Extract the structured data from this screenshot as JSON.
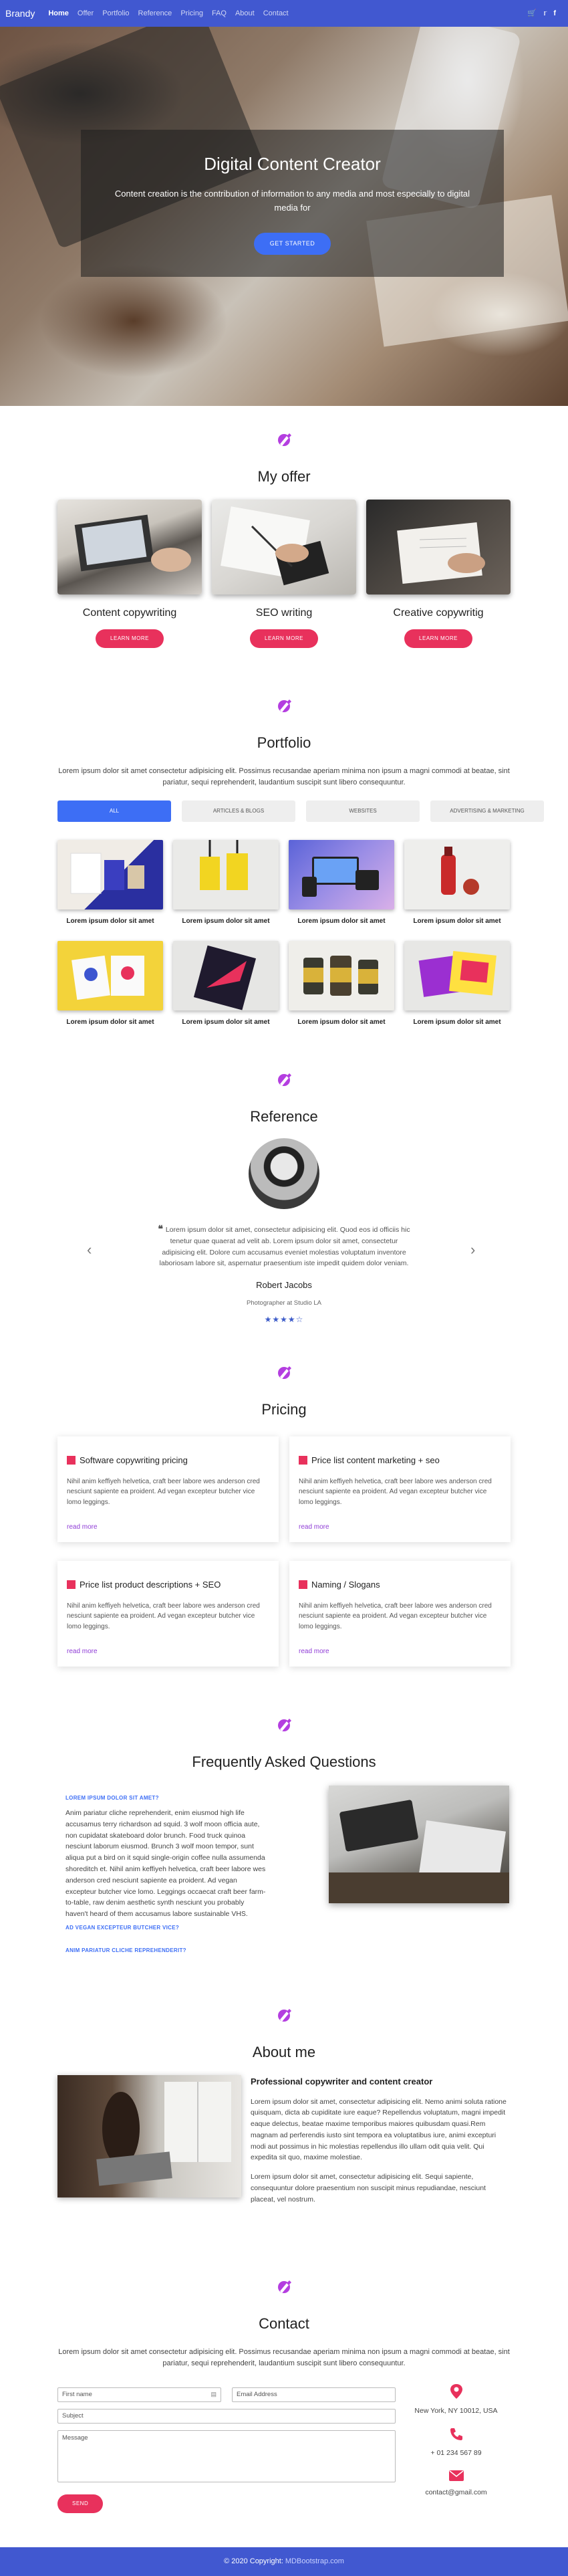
{
  "nav": {
    "brand": "Brandy",
    "links": [
      "Home",
      "Offer",
      "Portfolio",
      "Reference",
      "Pricing",
      "FAQ",
      "About",
      "Contact"
    ],
    "icons": [
      "cart-icon",
      "twitter-icon",
      "facebook-icon"
    ]
  },
  "hero": {
    "title": "Digital Content Creator",
    "subtitle": "Content creation is the contribution of information to any media and most especially to digital media for",
    "button": "GET STARTED"
  },
  "offer": {
    "title": "My offer",
    "cards": [
      {
        "title": "Content copywriting",
        "button": "LEARN MORE"
      },
      {
        "title": "SEO writing",
        "button": "LEARN MORE"
      },
      {
        "title": "Creative copywritig",
        "button": "LEARN MORE"
      }
    ]
  },
  "portfolio": {
    "title": "Portfolio",
    "description": "Lorem ipsum dolor sit amet consectetur adipisicing elit. Possimus recusandae aperiam minima non ipsum a magni commodi at beatae, sint pariatur, sequi reprehenderit, laudantium suscipit sunt libero consequuntur.",
    "filters": [
      "ALL",
      "ARTICLES & BLOGS",
      "WEBSITES",
      "ADVERTISING & MARKETING"
    ],
    "items": [
      "Lorem ipsum dolor sit amet",
      "Lorem ipsum dolor sit amet",
      "Lorem ipsum dolor sit amet",
      "Lorem ipsum dolor sit amet",
      "Lorem ipsum dolor sit amet",
      "Lorem ipsum dolor sit amet",
      "Lorem ipsum dolor sit amet",
      "Lorem ipsum dolor sit amet"
    ]
  },
  "reference": {
    "title": "Reference",
    "quote": "Lorem ipsum dolor sit amet, consectetur adipisicing elit. Quod eos id officiis hic tenetur quae quaerat ad velit ab. Lorem ipsum dolor sit amet, consectetur adipisicing elit. Dolore cum accusamus eveniet molestias voluptatum inventore laboriosam labore sit, aspernatur praesentium iste impedit quidem dolor veniam.",
    "name": "Robert Jacobs",
    "role": "Photographer at Studio LA",
    "rating": 4.5
  },
  "pricing": {
    "title": "Pricing",
    "cards": [
      {
        "title": "Software copywriting pricing",
        "text": "Nihil anim keffiyeh helvetica, craft beer labore wes anderson cred nesciunt sapiente ea proident. Ad vegan excepteur butcher vice lomo leggings.",
        "link": "read more"
      },
      {
        "title": "Price list content marketing + seo",
        "text": "Nihil anim keffiyeh helvetica, craft beer labore wes anderson cred nesciunt sapiente ea proident. Ad vegan excepteur butcher vice lomo leggings.",
        "link": "read more"
      },
      {
        "title": "Price list product descriptions + SEO",
        "text": "Nihil anim keffiyeh helvetica, craft beer labore wes anderson cred nesciunt sapiente ea proident. Ad vegan excepteur butcher vice lomo leggings.",
        "link": "read more"
      },
      {
        "title": "Naming / Slogans",
        "text": "Nihil anim keffiyeh helvetica, craft beer labore wes anderson cred nesciunt sapiente ea proident. Ad vegan excepteur butcher vice lomo leggings.",
        "link": "read more"
      }
    ]
  },
  "faq": {
    "title": "Frequently Asked Questions",
    "q1": "LOREM IPSUM DOLOR SIT AMET?",
    "a1": "Anim pariatur cliche reprehenderit, enim eiusmod high life accusamus terry richardson ad squid. 3 wolf moon officia aute, non cupidatat skateboard dolor brunch. Food truck quinoa nesciunt laborum eiusmod. Brunch 3 wolf moon tempor, sunt aliqua put a bird on it squid single-origin coffee nulla assumenda shoreditch et. Nihil anim keffiyeh helvetica, craft beer labore wes anderson cred nesciunt sapiente ea proident. Ad vegan excepteur butcher vice lomo. Leggings occaecat craft beer farm-to-table, raw denim aesthetic synth nesciunt you probably haven't heard of them accusamus labore sustainable VHS.",
    "q2": "AD VEGAN EXCEPTEUR BUTCHER VICE?",
    "q3": "ANIM PARIATUR CLICHE REPREHENDERIT?"
  },
  "about": {
    "title": "About me",
    "heading": "Professional copywriter and content creator",
    "p1": "Lorem ipsum dolor sit amet, consectetur adipisicing elit. Nemo animi soluta ratione quisquam, dicta ab cupiditate iure eaque? Repellendus voluptatum, magni impedit eaque delectus, beatae maxime temporibus maiores quibusdam quasi.Rem magnam ad perferendis iusto sint tempora ea voluptatibus iure, animi excepturi modi aut possimus in hic molestias repellendus illo ullam odit quia velit. Qui expedita sit quo, maxime molestiae.",
    "p2": "Lorem ipsum dolor sit amet, consectetur adipisicing elit. Sequi sapiente, consequuntur dolore praesentium non suscipit minus repudiandae, nesciunt placeat, vel nostrum."
  },
  "contact": {
    "title": "Contact",
    "description": "Lorem ipsum dolor sit amet consectetur adipisicing elit. Possimus recusandae aperiam minima non ipsum a magni commodi at beatae, sint pariatur, sequi reprehenderit, laudantium suscipit sunt libero consequuntur.",
    "first_name": "First name",
    "email": "Email Address",
    "subject": "Subject",
    "message": "Message",
    "send": "SEND",
    "address": "New York, NY 10012, USA",
    "phone": "+ 01 234 567 89",
    "mail": "contact@gmail.com"
  },
  "footer": {
    "copyright": "© 2020 Copyright:",
    "link": "MDBootstrap.com"
  },
  "colors": {
    "nav": "#4158d0",
    "accent_pink": "#e8315c",
    "accent_blue": "#3d6ef5",
    "section_icon": "#b43ee0"
  }
}
